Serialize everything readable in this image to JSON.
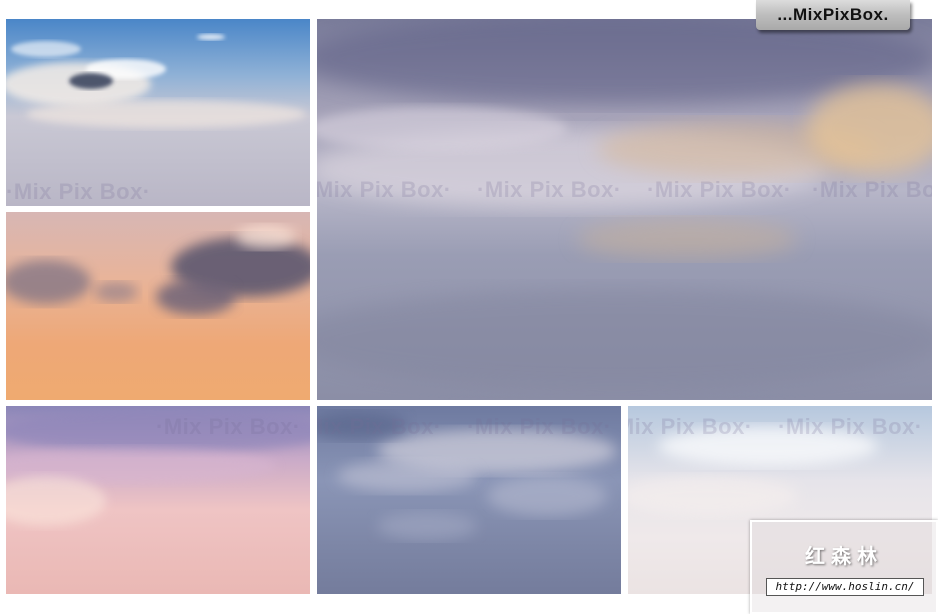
{
  "brand": {
    "label": "...MixPixBox."
  },
  "watermark": {
    "text": "·Mix Pix Box·"
  },
  "stamp": {
    "chinese": "红森林",
    "url": "http://www.hoslin.cn/"
  },
  "tiles": [
    {
      "name": "blue-sky-wispy-clouds"
    },
    {
      "name": "peach-sunset-dark-clouds"
    },
    {
      "name": "streaked-violet-clouds"
    },
    {
      "name": "pastel-pink-sky"
    },
    {
      "name": "blue-grey-streaked-clouds"
    },
    {
      "name": "pale-hazy-sky"
    }
  ],
  "colors": {
    "brand_bg": "#c4c4c4",
    "brand_text": "#111111",
    "stamp_text": "#ffffff"
  }
}
